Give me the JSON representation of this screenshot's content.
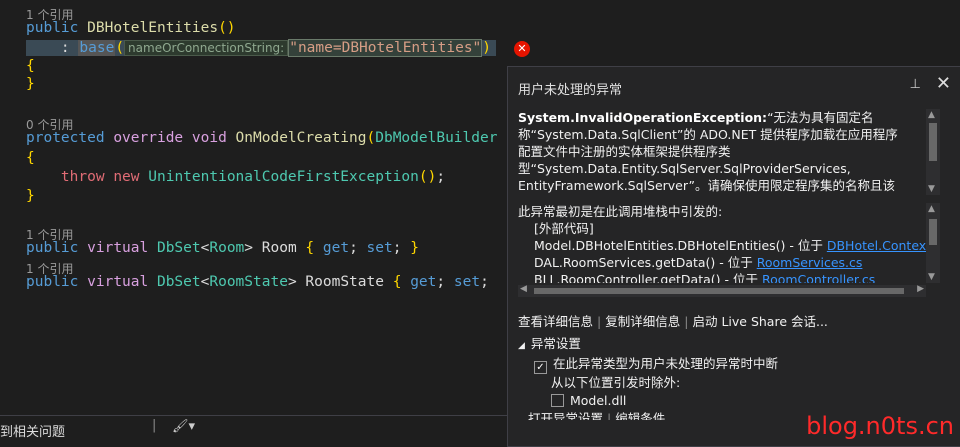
{
  "editor": {
    "lens1": "1 个引用",
    "ctor_kw": "public",
    "ctor_name": "DBHotelEntities",
    "ctor_parens": "()",
    "base_colon": "    : ",
    "base_kw": "base",
    "param_hint": "nameOrConnectionString:",
    "arg_string": "\"name=DBHotelEntities\"",
    "brace_open": "{",
    "brace_close": "}",
    "lens2": "0 个引用",
    "m2_kw1": "protected",
    "m2_kw2": "override",
    "m2_kw3": "void",
    "m2_name": "OnModelCreating",
    "m2_type": "DbModelBuilder",
    "throw_kw": "throw",
    "new_kw": "new",
    "exc_type": "UnintentionalCodeFirstException",
    "lens3": "1 个引用",
    "p1_kw1": "public",
    "p1_kw2": "virtual",
    "p1_type1": "DbSet",
    "p1_gen": "Room",
    "p1_name": "Room",
    "lens4": "1 个引用",
    "p2_gen": "RoomState",
    "p2_name": "RoomState",
    "get": "get",
    "set": "set"
  },
  "popup": {
    "title": "用户未处理的异常",
    "exception_type": "System.InvalidOperationException:",
    "message_lines": [
      "“无法为具有固定名",
      "称“System.Data.SqlClient”的 ADO.NET 提供程序加载在应用程序",
      "配置文件中注册的实体框架提供程序类",
      "型“System.Data.Entity.SqlServer.SqlProviderServices,",
      "EntityFramework.SqlServer”。请确保使用限定程序集的名称且该"
    ],
    "stack_header": "此异常最初是在此调用堆栈中引发的:",
    "stack_external": "[外部代码]",
    "stack_frames": [
      {
        "text": "Model.DBHotelEntities.DBHotelEntities() - 位于 ",
        "link": "DBHotel.Context.cs"
      },
      {
        "text": "DAL.RoomServices.getData() - 位于 ",
        "link": "RoomServices.cs"
      },
      {
        "text": "BLL.RoomController.getData() - 位于 ",
        "link": "RoomController.cs"
      }
    ],
    "action_view": "查看详细信息",
    "action_copy": "复制详细信息",
    "action_share": "启动 Live Share 会话...",
    "settings_header": "异常设置",
    "settings_break": "在此异常类型为用户未处理的异常时中断",
    "settings_except": "从以下位置引发时除外:",
    "settings_dll": "Model.dll",
    "settings_footer_open": "打开异常设置",
    "settings_footer_edit": "编辑条件"
  },
  "bottom": {
    "issues_text": "到相关问题"
  },
  "watermark": "blog.n0ts.cn"
}
